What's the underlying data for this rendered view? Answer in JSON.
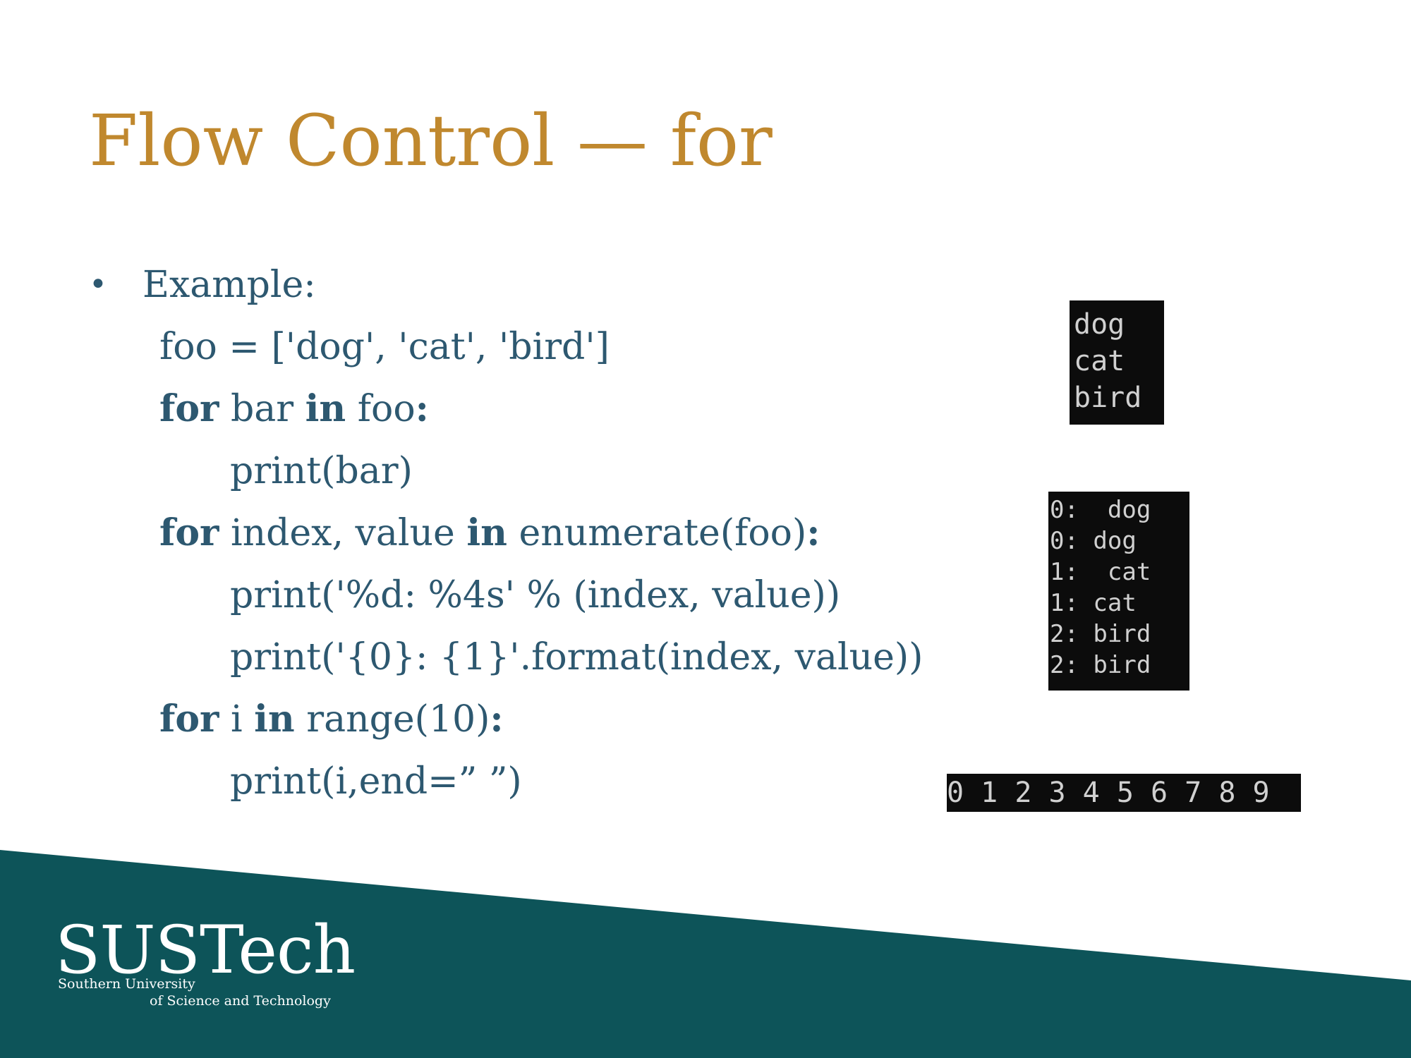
{
  "slide": {
    "title": "Flow Control — for",
    "bullet_marker": "•",
    "bullet_label": "Example:",
    "code": {
      "line1": "foo = ['dog', 'cat', 'bird']",
      "line2": {
        "kw1": "for",
        "t1": " bar ",
        "kw2": "in",
        "t2": " foo",
        "colon": ":"
      },
      "line3": "print(bar)",
      "line4": {
        "kw1": "for",
        "t1": " index, value ",
        "kw2": "in",
        "t2": " enumerate(foo)",
        "colon": ":"
      },
      "line5": "print('%d: %4s' % (index, value))",
      "line6": "print('{0}: {1}'.format(index, value))",
      "line7": {
        "kw1": "for",
        "t1": " i ",
        "kw2": "in",
        "t2": " range(10)",
        "colon": ":"
      },
      "line8": "print(i,end=” ”)"
    }
  },
  "outputs": {
    "output1": [
      "dog",
      "cat",
      "bird"
    ],
    "output2": [
      "0:  dog",
      "0: dog",
      "1:  cat",
      "1: cat",
      "2: bird",
      "2: bird"
    ],
    "output3": [
      "0 1 2 3 4 5 6 7 8 9"
    ]
  },
  "footer": {
    "logo_main": "SUSTech",
    "logo_sub1": "Southern University",
    "logo_sub2": "of Science and Technology"
  },
  "colors": {
    "title": "#c0882e",
    "body_text": "#2d5870",
    "footer_band": "#0d5459",
    "console_bg": "#0c0c0c",
    "console_text": "#d0d0d0"
  }
}
